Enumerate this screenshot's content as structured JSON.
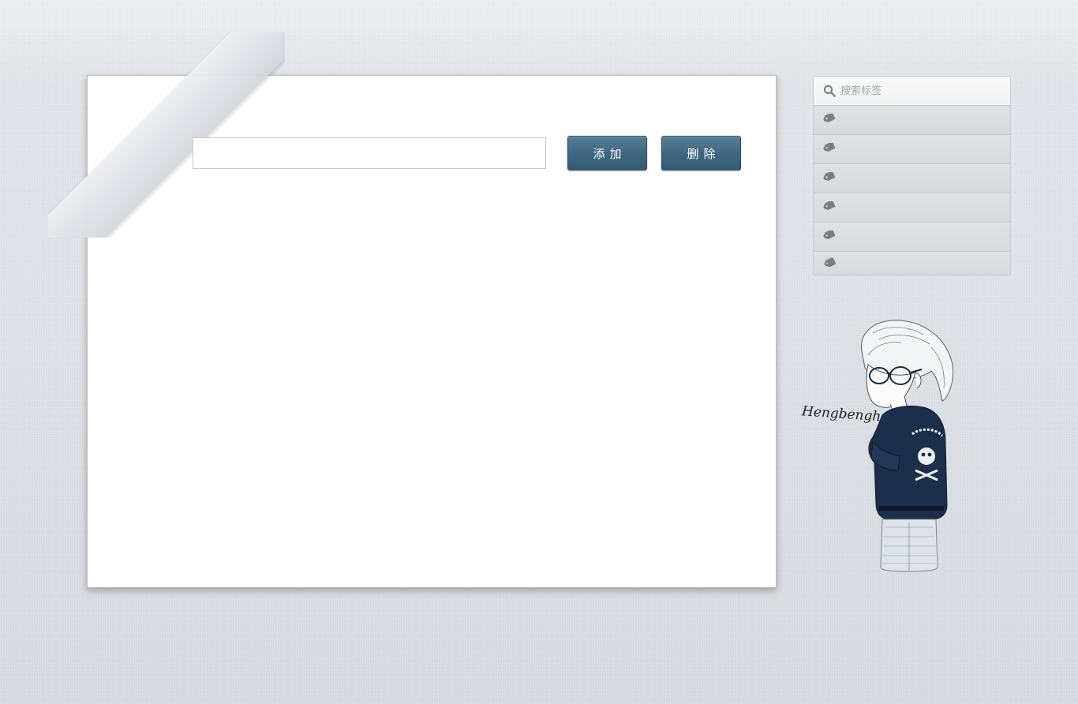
{
  "main": {
    "input_value": "",
    "add_label": "添加",
    "delete_label": "删除"
  },
  "sidebar": {
    "search_placeholder": "搜索标签",
    "tags": [
      {
        "label": "",
        "icon": "tag-icon"
      },
      {
        "label": "",
        "icon": "tag-icon"
      },
      {
        "label": "",
        "icon": "tag-icon"
      },
      {
        "label": "",
        "icon": "tag-icon"
      },
      {
        "label": "",
        "icon": "tag-icon"
      },
      {
        "label": "",
        "icon": "tags-icon"
      }
    ]
  },
  "illustration": {
    "signature": "Hengbengheng~"
  },
  "colors": {
    "button": "#3f6880",
    "background": "#dde1e6",
    "jacket": "#1b2f4a"
  }
}
